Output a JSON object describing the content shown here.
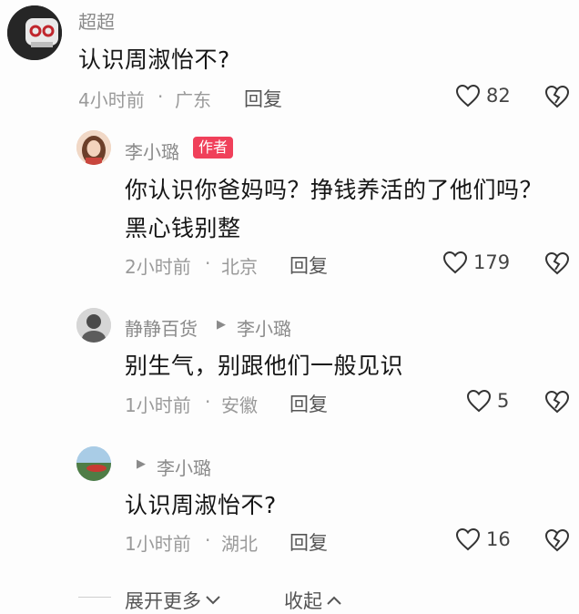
{
  "comment": {
    "author": "超超",
    "text": "认识周淑怡不?",
    "time": "4小时前",
    "location": "广东",
    "reply_label": "回复",
    "likes": "82"
  },
  "replies": [
    {
      "author": "李小璐",
      "badge": "作者",
      "text_line1": "你认识你爸妈吗？挣钱养活的了他们吗？",
      "text_line2": "黑心钱别整",
      "time": "2小时前",
      "location": "北京",
      "reply_label": "回复",
      "likes": "179"
    },
    {
      "author": "静静百货",
      "reply_to": "李小璐",
      "text": "别生气，别跟他们一般见识",
      "time": "1小时前",
      "location": "安徽",
      "reply_label": "回复",
      "likes": "5"
    },
    {
      "reply_to": "李小璐",
      "text": "认识周淑怡不?",
      "time": "1小时前",
      "location": "湖北",
      "reply_label": "回复",
      "likes": "16"
    }
  ],
  "footer": {
    "expand_label": "展开更多",
    "collapse_label": "收起"
  },
  "colors": {
    "badge": "#f0405a",
    "meta_text": "#9a9a9a"
  },
  "icons": {
    "like": "heart-outline-icon",
    "dislike": "broken-heart-icon",
    "reply_arrow": "play-triangle-icon"
  }
}
